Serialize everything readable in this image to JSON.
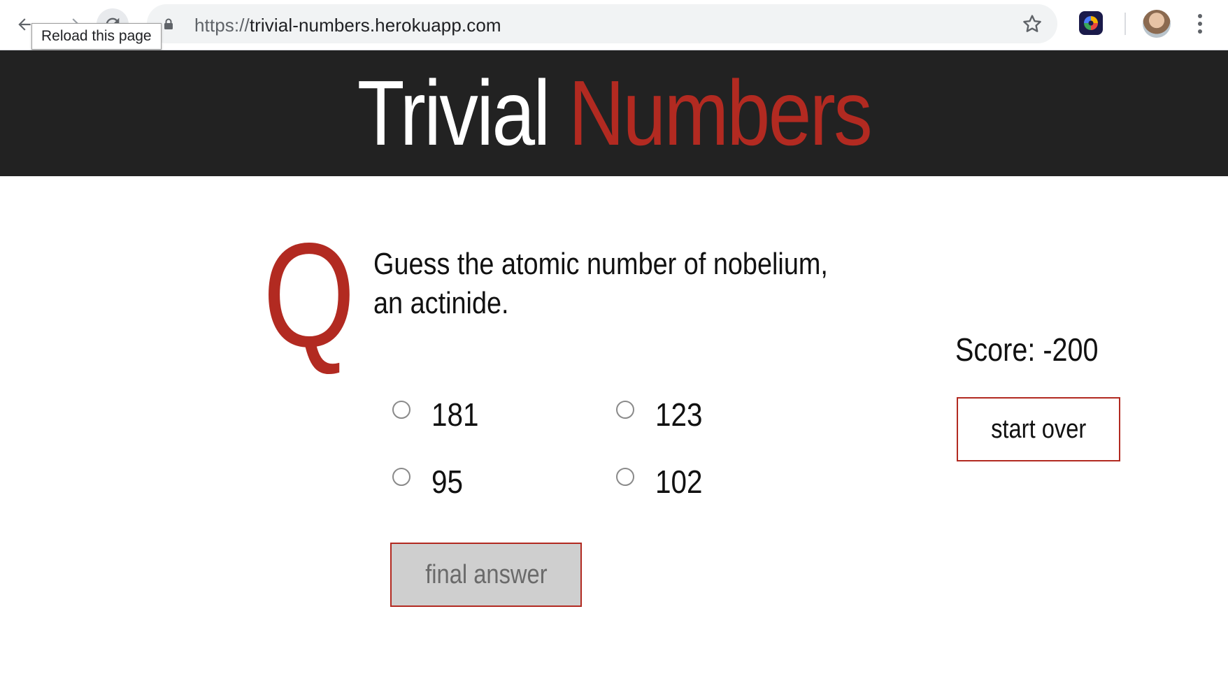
{
  "browser": {
    "url_scheme": "https://",
    "url_host": "trivial-numbers.herokuapp.com",
    "tooltip": "Reload this page",
    "icons": {
      "back": "back-arrow-icon",
      "forward": "forward-arrow-icon",
      "reload": "reload-icon",
      "lock": "lock-icon",
      "bookmark": "star-icon",
      "extension": "extension-icon",
      "profile": "avatar",
      "menu": "kebab-menu-icon"
    }
  },
  "header": {
    "title_part1": "Trivial",
    "title_part2": "Numbers"
  },
  "question": {
    "marker": "Q",
    "text": "Guess the atomic number of nobelium, an actinide.",
    "choices": [
      {
        "label": "181",
        "selected": false
      },
      {
        "label": "123",
        "selected": false
      },
      {
        "label": "95",
        "selected": false
      },
      {
        "label": "102",
        "selected": false
      }
    ],
    "submit_label": "final answer"
  },
  "sidebar": {
    "score_text": "Score: -200",
    "start_over_label": "start over"
  },
  "colors": {
    "accent": "#b22a21",
    "header_bg": "#222222",
    "disabled_button_bg": "#cfcfcf"
  }
}
